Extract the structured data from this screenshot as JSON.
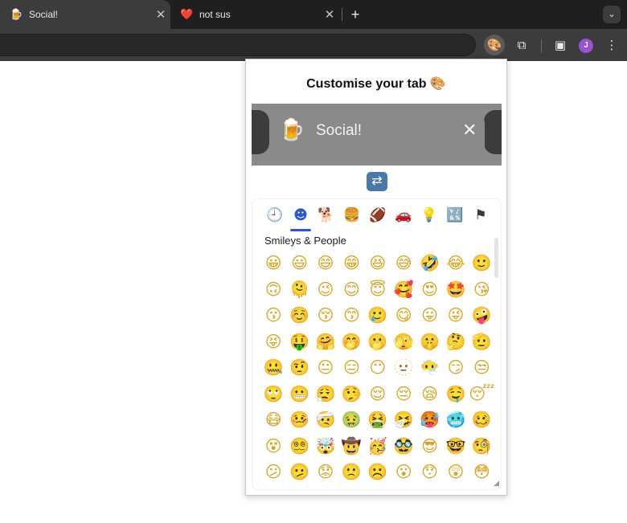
{
  "browser": {
    "tabs": [
      {
        "favicon": "🍺",
        "title": "Social!"
      },
      {
        "favicon": "❤️",
        "title": "not sus"
      }
    ],
    "new_tab": "+",
    "tab_search": "⌄",
    "toolbar": {
      "extension_active_icon": "🎨",
      "extension_puzzle_icon": "⧉",
      "side_panel_icon": "▣",
      "avatar_initial": "J",
      "menu_icon": "⋮"
    }
  },
  "popup": {
    "title": "Customise your tab 🎨",
    "preview": {
      "emoji": "🍺",
      "title": "Social!",
      "close": "✕"
    },
    "shuffle_icon": "🔀",
    "categories": [
      {
        "icon": "🕘",
        "name": "recent"
      },
      {
        "icon": "☻",
        "name": "smileys-people"
      },
      {
        "icon": "🐕",
        "name": "animals-nature"
      },
      {
        "icon": "🍔",
        "name": "food-drink"
      },
      {
        "icon": "🏈",
        "name": "activity"
      },
      {
        "icon": "🚗",
        "name": "travel-places"
      },
      {
        "icon": "💡",
        "name": "objects"
      },
      {
        "icon": "🔣",
        "name": "symbols"
      },
      {
        "icon": "⚑",
        "name": "flags"
      }
    ],
    "section_label": "Smileys & People",
    "emojis": [
      "😀",
      "😃",
      "😄",
      "😁",
      "😆",
      "😅",
      "🤣",
      "😂",
      "🙂",
      "🙃",
      "🫠",
      "😉",
      "😊",
      "😇",
      "🥰",
      "😍",
      "🤩",
      "😘",
      "😗",
      "☺️",
      "😚",
      "😙",
      "🥲",
      "😋",
      "😛",
      "😜",
      "🤪",
      "😝",
      "🤑",
      "🤗",
      "🤭",
      "🫢",
      "🫣",
      "🤫",
      "🤔",
      "🫡",
      "🤐",
      "🤨",
      "😐",
      "😑",
      "😶",
      "🫥",
      "😶‍🌫️",
      "😏",
      "😒",
      "🙄",
      "😬",
      "😮‍💨",
      "🤥",
      "😌",
      "😔",
      "😪",
      "🤤",
      "😴",
      "😷",
      "🤒",
      "🤕",
      "🤢",
      "🤮",
      "🤧",
      "🥵",
      "🥶",
      "🥴",
      "😵",
      "😵‍💫",
      "🤯",
      "🤠",
      "🥳",
      "🥸",
      "😎",
      "🤓",
      "🧐",
      "😕",
      "🫤",
      "😟",
      "🙁",
      "☹️",
      "😮",
      "😯",
      "😲",
      "😳"
    ]
  }
}
